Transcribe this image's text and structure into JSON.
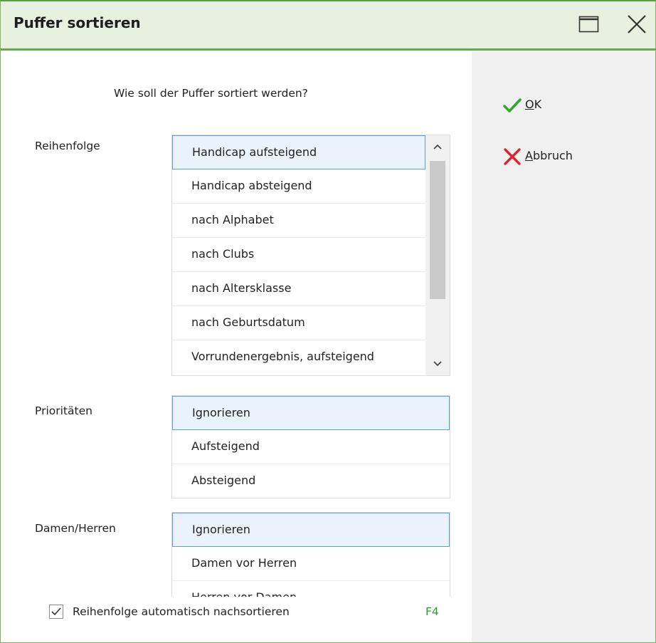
{
  "window": {
    "title": "Puffer sortieren"
  },
  "question": "Wie soll der Puffer sortiert werden?",
  "sections": {
    "order": {
      "label": "Reihenfolge",
      "items": [
        "Handicap aufsteigend",
        "Handicap absteigend",
        "nach Alphabet",
        "nach Clubs",
        "nach Altersklasse",
        "nach Geburtsdatum",
        "Vorrundenergebnis, aufsteigend"
      ],
      "selected_index": 0
    },
    "priorities": {
      "label": "Prioritäten",
      "items": [
        "Ignorieren",
        "Aufsteigend",
        "Absteigend"
      ],
      "selected_index": 0
    },
    "gender": {
      "label": "Damen/Herren",
      "items": [
        "Ignorieren",
        "Damen vor Herren",
        "Herren vor Damen"
      ],
      "selected_index": 0
    }
  },
  "auto_sort": {
    "label": "Reihenfolge automatisch nachsortieren",
    "checked": true,
    "shortcut": "F4"
  },
  "actions": {
    "ok": {
      "mnemonic": "O",
      "rest": "K",
      "icon": "checkmark-icon",
      "color": "#3aa335"
    },
    "cancel": {
      "mnemonic": "A",
      "rest": "bbruch",
      "icon": "cross-icon",
      "color": "#e0242a"
    }
  },
  "colors": {
    "title_bar": "#e6f1df",
    "title_border": "#6aa64d",
    "selection_fill": "#eaf3fc",
    "selection_border": "#5aa0e0",
    "shortcut": "#2e9a2e",
    "side_panel": "#f0f0f0"
  }
}
